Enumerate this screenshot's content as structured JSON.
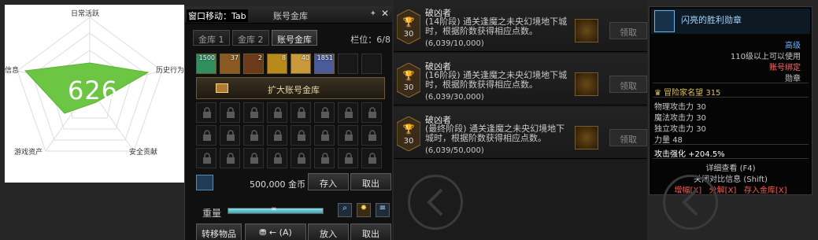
{
  "radar": {
    "labels": [
      "日常活跃",
      "历史行为",
      "安全贡献",
      "游戏资产",
      "信息"
    ],
    "score": "626",
    "colors": {
      "fill": "#6cc644",
      "grid": "#dddddd"
    }
  },
  "vault": {
    "hint": "窗口移动：Tab",
    "title": "账号金库",
    "tabs": [
      "金库 1",
      "金库 2",
      "账号金库"
    ],
    "columns_label": "栏位：6/8",
    "items": [
      {
        "count": "1500",
        "icon": "crystal-icon",
        "color": "#2f8f5f"
      },
      {
        "count": "37",
        "icon": "scroll-icon",
        "color": "#8a5a20"
      },
      {
        "count": "2",
        "icon": "scroll-icon",
        "color": "#6a3a1a"
      },
      {
        "count": "8",
        "icon": "orb-icon",
        "color": "#b88a1a"
      },
      {
        "count": "40",
        "icon": "chest-icon",
        "color": "#c89a3a"
      },
      {
        "count": "1851",
        "icon": "gem-icon",
        "color": "#4a5a9a"
      }
    ],
    "expand_label": "扩大账号金库",
    "gold_amount": "500,000 金币",
    "deposit_label": "存入",
    "withdraw_label": "取出",
    "weight_label": "重量",
    "weight_value": "∞",
    "weight_fill": 1.0,
    "transfer_label": "转移物品",
    "transfer_key": "(A)",
    "put_label": "放入",
    "take_label": "取出"
  },
  "achievements": [
    {
      "title": "破凶者",
      "desc": "(14阶段) 通关逢魔之未央幻境地下城时，根据阶数获得相应点数。",
      "progress": "(6,039/10,000)",
      "points": "30",
      "claim_label": "领取"
    },
    {
      "title": "破凶者",
      "desc": "(16阶段) 通关逢魔之未央幻境地下城时，根据阶数获得相应点数。",
      "progress": "(6,039/30,000)",
      "points": "30",
      "claim_label": "领取"
    },
    {
      "title": "破凶者",
      "desc": "(最终阶段) 通关逢魔之未央幻境地下城时，根据阶数获得相应点数。",
      "progress": "(6,039/50,000)",
      "points": "30",
      "claim_label": "领取"
    }
  ],
  "tooltip": {
    "name": "闪亮的胜利勋章",
    "grade": "高级",
    "level_req": "110级以上可以使用",
    "bind": "账号绑定",
    "type": "勋章",
    "fame": "冒险家名望 315",
    "stats": [
      {
        "label": "物理攻击力",
        "value": "30"
      },
      {
        "label": "魔法攻击力",
        "value": "30"
      },
      {
        "label": "独立攻击力",
        "value": "30"
      },
      {
        "label": "力量",
        "value": "48"
      }
    ],
    "enhance": "攻击强化 +204.5%",
    "detail": "详细查看 (F4)",
    "compare": "关闭对比信息 (Shift)",
    "actions": [
      "增幅[X]",
      "分解[X]",
      "存入金库[X]"
    ],
    "colors": {
      "name": "#9fd3ff",
      "grade": "#6fb0ff",
      "bind": "#ff6a6a",
      "action": "#ff5a4a"
    }
  }
}
